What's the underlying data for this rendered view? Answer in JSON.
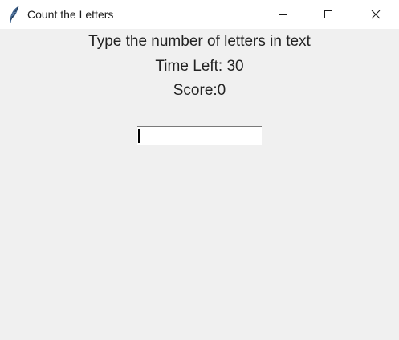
{
  "window": {
    "title": "Count the Letters",
    "icon": "feather-icon",
    "controls": {
      "minimize": "minimize-icon",
      "maximize": "maximize-icon",
      "close": "close-icon"
    }
  },
  "game": {
    "instructions": "Type the number of letters in text",
    "time_left": "Time Left: 30",
    "score": "Score:0",
    "entry_value": ""
  }
}
